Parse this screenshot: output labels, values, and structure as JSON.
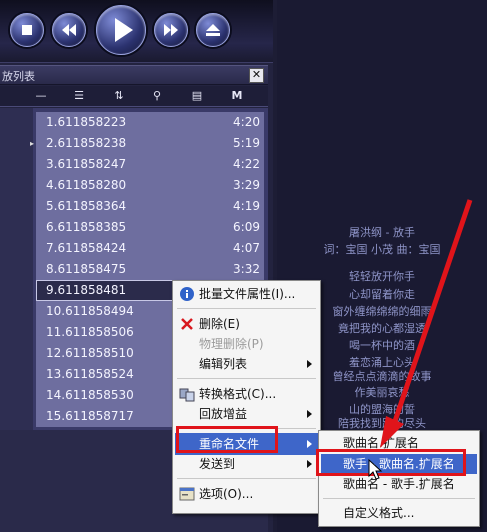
{
  "playlist": {
    "title": "放列表",
    "close_glyph": "✕",
    "toolbar": [
      {
        "name": "remove-tool",
        "glyph": "—"
      },
      {
        "name": "list-tool",
        "glyph": "☰"
      },
      {
        "name": "sort-tool",
        "glyph": "⇅"
      },
      {
        "name": "search-tool",
        "glyph": "⚲"
      },
      {
        "name": "file-tool",
        "glyph": "▤"
      },
      {
        "name": "m-tool",
        "glyph": "M"
      }
    ],
    "rows": [
      {
        "title": "1.611858223",
        "duration": "4:20"
      },
      {
        "title": "2.611858238",
        "duration": "5:19"
      },
      {
        "title": "3.611858247",
        "duration": "4:22"
      },
      {
        "title": "4.611858280",
        "duration": "3:29"
      },
      {
        "title": "5.611858364",
        "duration": "4:19"
      },
      {
        "title": "6.611858385",
        "duration": "6:09"
      },
      {
        "title": "7.611858424",
        "duration": "4:07"
      },
      {
        "title": "8.611858475",
        "duration": "3:32"
      },
      {
        "title": "9.611858481",
        "duration": ""
      },
      {
        "title": "10.611858494",
        "duration": ""
      },
      {
        "title": "11.611858506",
        "duration": ""
      },
      {
        "title": "12.611858510",
        "duration": ""
      },
      {
        "title": "13.611858524",
        "duration": ""
      },
      {
        "title": "14.611858530",
        "duration": ""
      },
      {
        "title": "15.611858717",
        "duration": ""
      }
    ],
    "selected_index": 8
  },
  "lyrics": {
    "lines": [
      "屠洪纲 - 放手",
      "词：宝国 小茂 曲：宝国",
      "",
      "轻轻放开你手",
      "心却留着你走",
      "窗外缠绵绵绵的细雨",
      "竟把我的心都湿透",
      "喝一杯中的酒",
      "羞恋涌上心头",
      "曾经点点滴滴的故事",
      "作美丽哀愁",
      "山的盟海的誓",
      "陪我找到路的尽头"
    ]
  },
  "context_menu": {
    "items": [
      {
        "label": "批量文件属性(I)...",
        "icon": "info-icon"
      },
      {
        "label": "删除(E)",
        "icon": "delete-x-icon"
      },
      {
        "label": "物理删除(P)",
        "disabled": true
      },
      {
        "label": "编辑列表",
        "submenu": true
      },
      {
        "label": "转换格式(C)...",
        "icon": "convert-icon"
      },
      {
        "label": "回放增益",
        "submenu": true
      },
      {
        "label": "重命名文件",
        "submenu": true,
        "highlighted": true
      },
      {
        "label": "发送到",
        "submenu": true
      },
      {
        "label": "选项(O)...",
        "icon": "options-icon"
      }
    ]
  },
  "rename_submenu": {
    "items": [
      {
        "label": "歌曲名.扩展名"
      },
      {
        "label": "歌手 - 歌曲名.扩展名",
        "highlighted": true
      },
      {
        "label": "歌曲名 - 歌手.扩展名"
      },
      {
        "label": "自定义格式..."
      }
    ]
  },
  "colors": {
    "annotation": "#e0141a",
    "menu_highlight": "#3e66c9"
  }
}
